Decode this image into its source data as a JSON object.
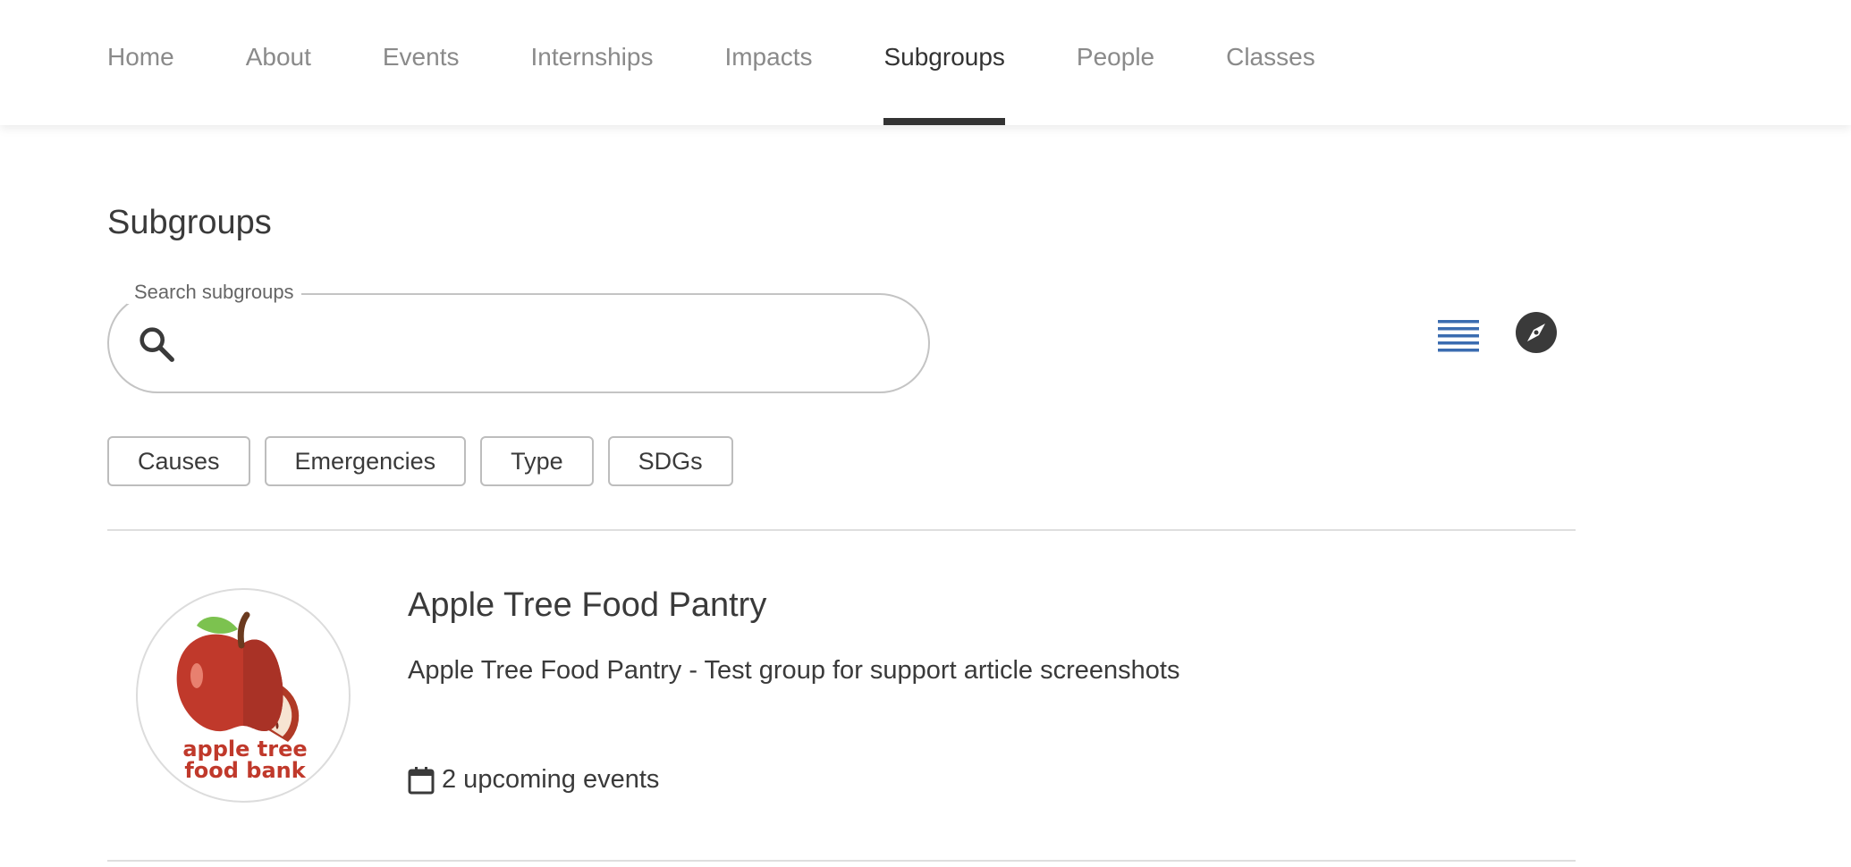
{
  "nav": {
    "tabs": [
      {
        "label": "Home"
      },
      {
        "label": "About"
      },
      {
        "label": "Events"
      },
      {
        "label": "Internships"
      },
      {
        "label": "Impacts"
      },
      {
        "label": "Subgroups",
        "active": true
      },
      {
        "label": "People"
      },
      {
        "label": "Classes"
      }
    ]
  },
  "page": {
    "title": "Subgroups"
  },
  "search": {
    "legend": "Search subgroups",
    "value": "",
    "icon": "search-icon"
  },
  "view_toggles": {
    "list_icon": "list-view-icon",
    "explore_icon": "compass-icon",
    "list_color": "#3b6cb0",
    "explore_color": "#3a3a3a"
  },
  "filters": [
    {
      "label": "Causes"
    },
    {
      "label": "Emergencies"
    },
    {
      "label": "Type"
    },
    {
      "label": "SDGs"
    }
  ],
  "groups": [
    {
      "name": "Apple Tree Food Pantry",
      "description": "Apple Tree Food Pantry - Test group for support article screenshots",
      "events": "2 upcoming events",
      "logo_text_line1": "apple tree",
      "logo_text_line2": "food bank",
      "logo_color": "#c0392b"
    }
  ]
}
